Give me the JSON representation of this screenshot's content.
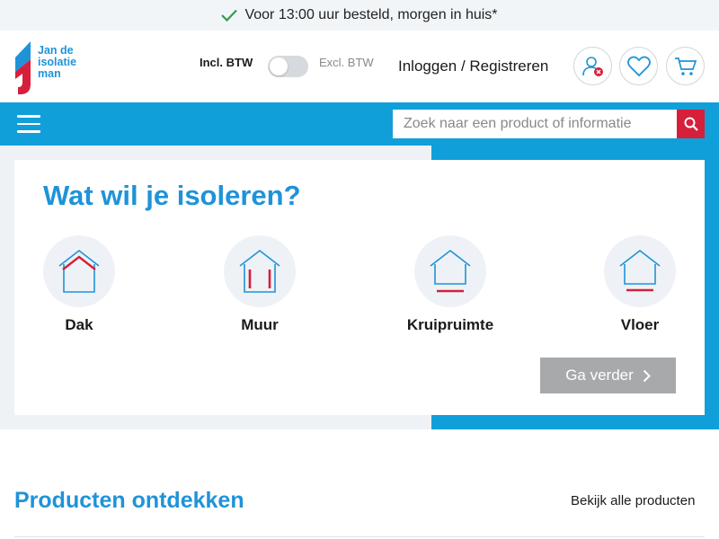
{
  "topbar": {
    "text": "Voor 13:00 uur besteld, morgen in huis*",
    "icon": "checkmark-icon"
  },
  "logo": {
    "line1": "Jan de",
    "line2": "isolatie",
    "line3": "man",
    "colors": {
      "blue": "#1f93d8",
      "red": "#d61f3b"
    }
  },
  "header": {
    "btw_incl": "Incl. BTW",
    "btw_excl": "Excl. BTW",
    "btw_toggle_on": false,
    "login": "Inloggen / Registreren",
    "icons": [
      "account-icon",
      "heart-icon",
      "cart-icon"
    ]
  },
  "nav": {
    "menu_icon": "hamburger-icon",
    "search_placeholder": "Zoek naar een product of informatie",
    "search_icon": "search-icon"
  },
  "hero": {
    "title": "Wat wil je isoleren?",
    "options": [
      {
        "label": "Dak",
        "icon": "roof-house-icon"
      },
      {
        "label": "Muur",
        "icon": "wall-house-icon"
      },
      {
        "label": "Kruipruimte",
        "icon": "crawlspace-house-icon"
      },
      {
        "label": "Vloer",
        "icon": "floor-house-icon"
      }
    ],
    "button": "Ga verder"
  },
  "products": {
    "title": "Producten ontdekken",
    "link": "Bekijk alle producten"
  },
  "colors": {
    "primary_blue": "#119fda",
    "accent_red": "#d61f3b",
    "button_gray": "#a7a9ab"
  }
}
